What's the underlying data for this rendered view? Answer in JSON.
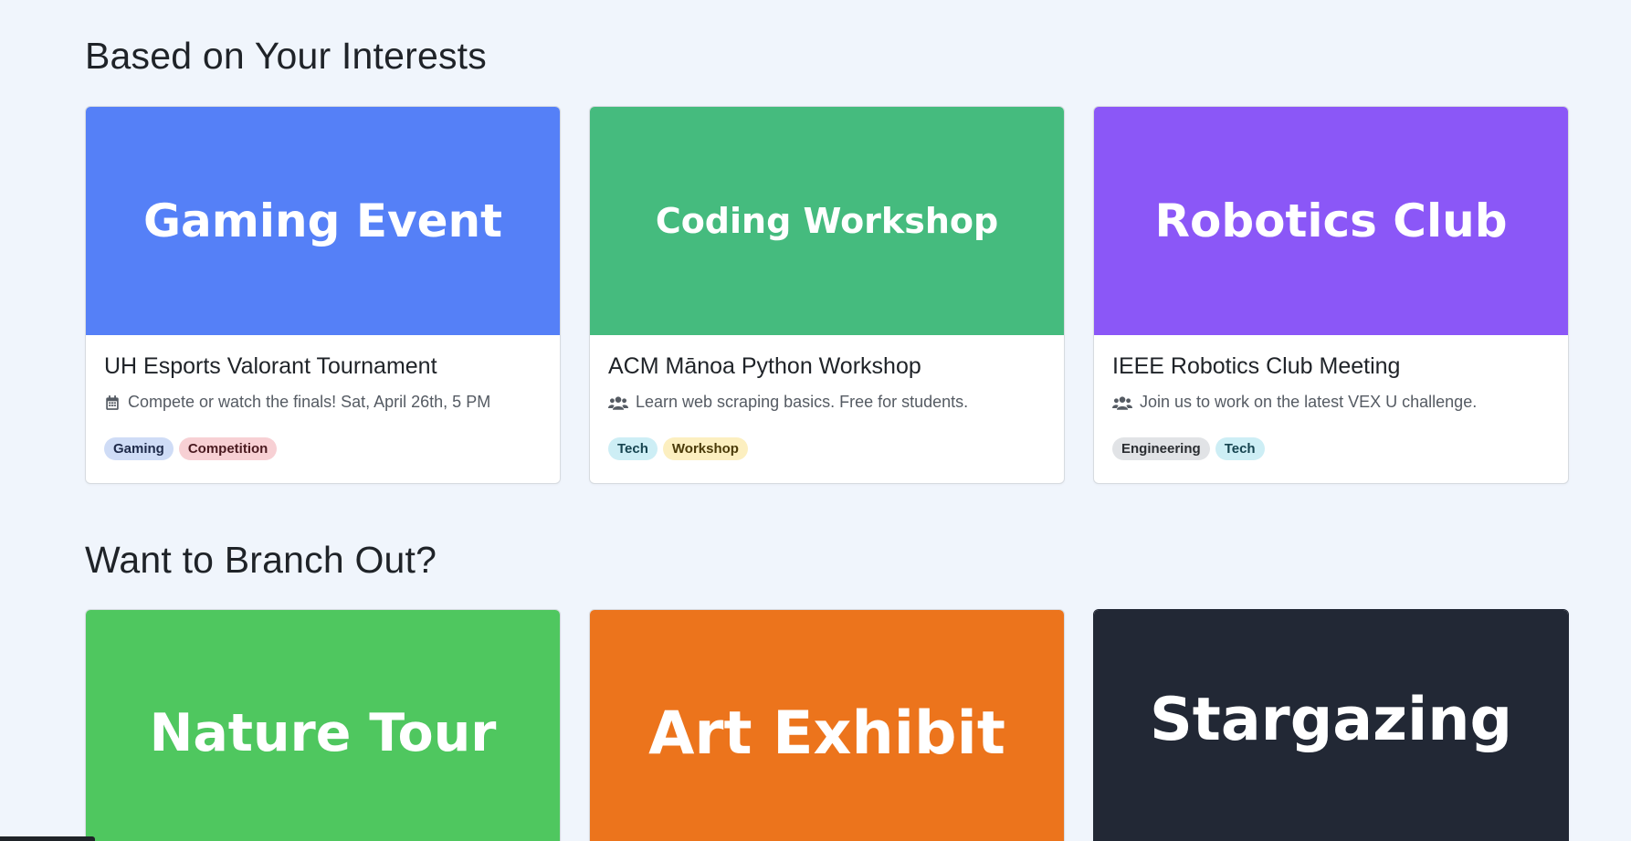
{
  "sections": [
    {
      "title": "Based on Your Interests",
      "cards": [
        {
          "banner": "Gaming Event",
          "banner_color": "#5580f7",
          "title": "UH Esports Valorant Tournament",
          "icon": "calendar-icon",
          "description": "Compete or watch the finals! Sat, April 26th, 5 PM",
          "tags": [
            "Gaming",
            "Competition"
          ]
        },
        {
          "banner": "Coding Workshop",
          "banner_color": "#45bb7e",
          "title": "ACM Mānoa Python Workshop",
          "icon": "users-icon",
          "description": "Learn web scraping basics. Free for students.",
          "tags": [
            "Tech",
            "Workshop"
          ]
        },
        {
          "banner": "Robotics Club",
          "banner_color": "#8b57f7",
          "title": "IEEE Robotics Club Meeting",
          "icon": "users-icon",
          "description": "Join us to work on the latest VEX U challenge.",
          "tags": [
            "Engineering",
            "Tech"
          ]
        }
      ]
    },
    {
      "title": "Want to Branch Out?",
      "cards": [
        {
          "banner": "Nature Tour",
          "banner_color": "#4fc75f"
        },
        {
          "banner": "Art Exhibit",
          "banner_color": "#ec741c"
        },
        {
          "banner": "Stargazing",
          "banner_color": "#222835"
        }
      ]
    }
  ]
}
